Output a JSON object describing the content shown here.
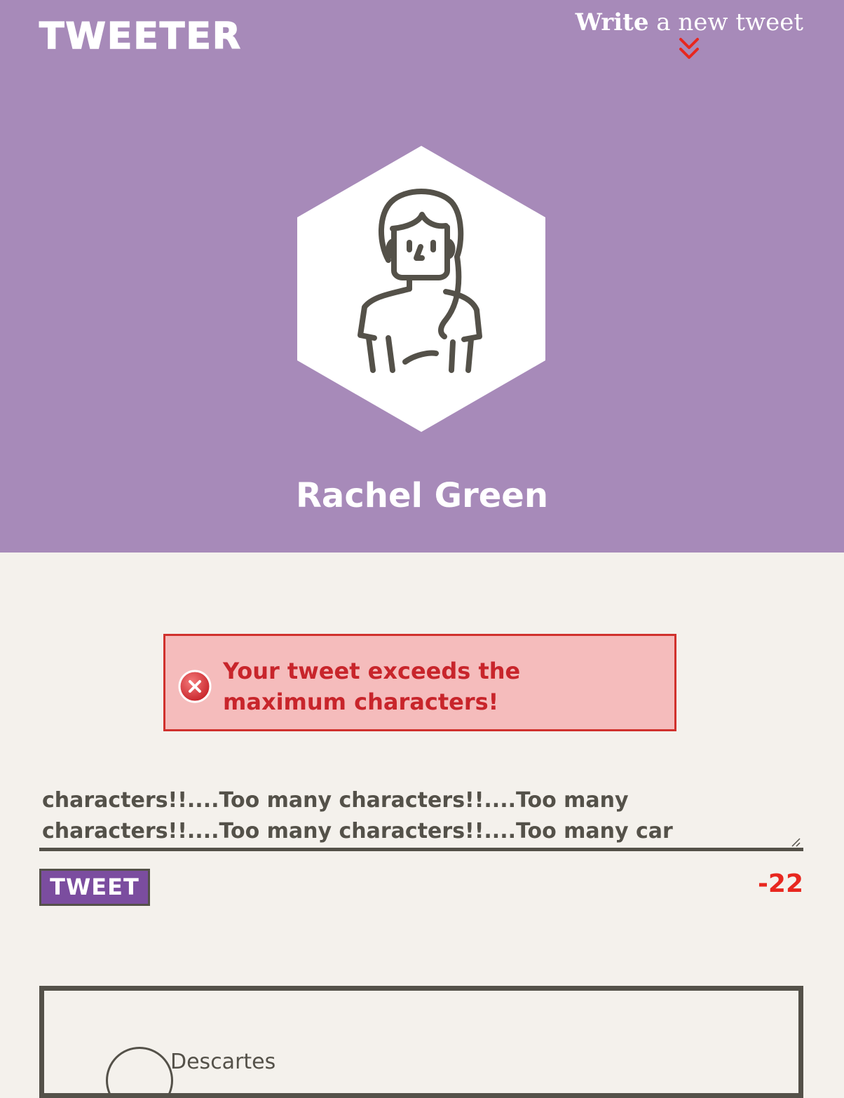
{
  "header": {
    "logo": "TWEETER",
    "write_link": {
      "strong": "Write",
      "rest": " a new tweet"
    },
    "user_name": "Rachel Green",
    "background_color": "#a78ab9"
  },
  "error": {
    "message": "Your tweet exceeds the maximum characters!",
    "icon": "error-x-icon",
    "color": "#c8252b"
  },
  "compose": {
    "visible_text": "characters!!....Too many characters!!....Too many\ncharacters!!....Too many characters!!....Too many car",
    "button_label": "TWEET",
    "counter": "-22",
    "counter_color": "#e8271f",
    "button_color": "#7b4d9f"
  },
  "tweets": [
    {
      "name": "Descartes"
    }
  ]
}
